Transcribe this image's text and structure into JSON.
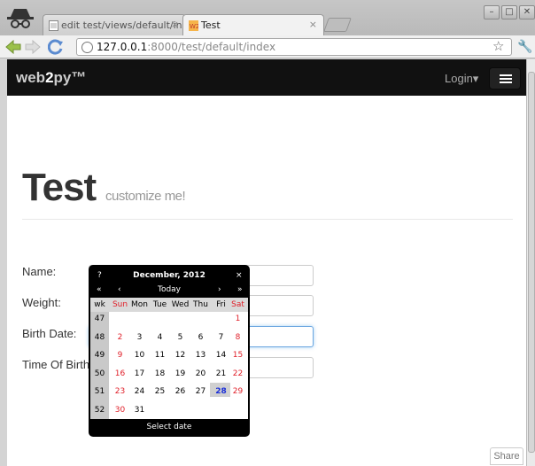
{
  "browser": {
    "tabs": [
      {
        "label": "edit test/views/default/inde",
        "active": false
      },
      {
        "label": "Test",
        "active": true
      }
    ],
    "url": {
      "host": "127.0.0.1",
      "rest": ":8000/test/default/index"
    },
    "window_controls": {
      "minimize": "–",
      "maximize": "□",
      "close": "✕"
    }
  },
  "navbar": {
    "brand_prefix": "web",
    "brand_bold": "2",
    "brand_suffix": "py™",
    "login": "Login▾"
  },
  "page": {
    "title": "Test",
    "subtitle": "customize me!"
  },
  "form": {
    "name_label": "Name:",
    "weight_label": "Weight:",
    "birth_date_label": "Birth Date:",
    "time_of_birth_label": "Time Of Birth:"
  },
  "calendar": {
    "help": "?",
    "month": "December, 2012",
    "close": "×",
    "prev_year": "«",
    "prev_month": "‹",
    "today": "Today",
    "next_month": "›",
    "next_year": "»",
    "week_label": "wk",
    "days": [
      "Sun",
      "Mon",
      "Tue",
      "Wed",
      "Thu",
      "Fri",
      "Sat"
    ],
    "weeks": [
      {
        "wk": "47",
        "days": [
          "",
          "",
          "",
          "",
          "",
          "",
          "1"
        ]
      },
      {
        "wk": "48",
        "days": [
          "2",
          "3",
          "4",
          "5",
          "6",
          "7",
          "8"
        ]
      },
      {
        "wk": "49",
        "days": [
          "9",
          "10",
          "11",
          "12",
          "13",
          "14",
          "15"
        ]
      },
      {
        "wk": "50",
        "days": [
          "16",
          "17",
          "18",
          "19",
          "20",
          "21",
          "22"
        ]
      },
      {
        "wk": "51",
        "days": [
          "23",
          "24",
          "25",
          "26",
          "27",
          "28",
          "29"
        ]
      },
      {
        "wk": "52",
        "days": [
          "30",
          "31",
          "",
          "",
          "",
          "",
          ""
        ]
      }
    ],
    "today_date": "28",
    "footer": "Select date",
    "colors": {
      "weekend": "#e0202a",
      "today": "#1a2ed8"
    }
  },
  "share": "Share"
}
